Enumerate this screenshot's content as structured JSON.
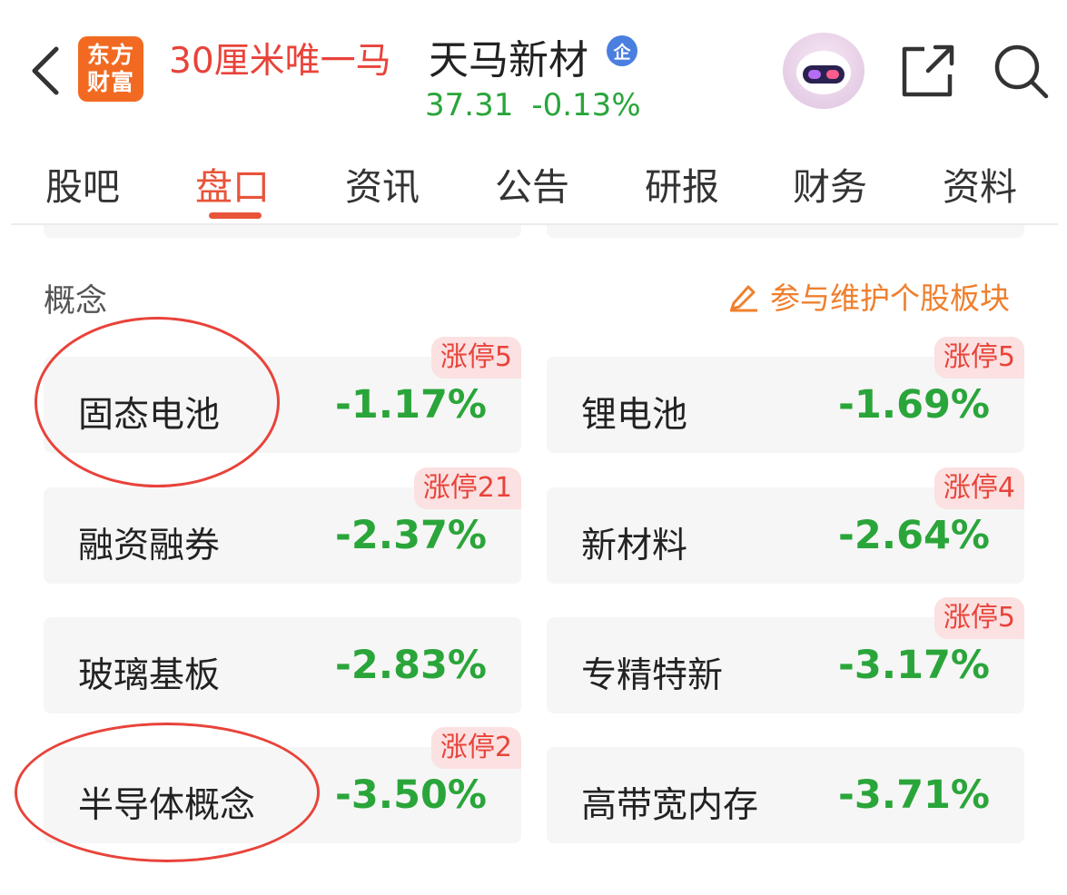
{
  "header": {
    "logo_line1": "东方",
    "logo_line2": "财富",
    "annotation": "30厘米唯一马",
    "stock_name": "天马新材",
    "badge": "企",
    "price": "37.31",
    "change": "-0.13%"
  },
  "tabs": [
    "股吧",
    "盘口",
    "资讯",
    "公告",
    "研报",
    "财务",
    "资料"
  ],
  "active_tab": "盘口",
  "concepts": {
    "title": "概念",
    "maintain_link": "参与维护个股板块",
    "items": [
      {
        "name": "固态电池",
        "change": "-1.17%",
        "limit_up": "涨停5"
      },
      {
        "name": "锂电池",
        "change": "-1.69%",
        "limit_up": "涨停5"
      },
      {
        "name": "融资融券",
        "change": "-2.37%",
        "limit_up": "涨停21"
      },
      {
        "name": "新材料",
        "change": "-2.64%",
        "limit_up": "涨停4"
      },
      {
        "name": "玻璃基板",
        "change": "-2.83%",
        "limit_up": ""
      },
      {
        "name": "专精特新",
        "change": "-3.17%",
        "limit_up": "涨停5"
      },
      {
        "name": "半导体概念",
        "change": "-3.50%",
        "limit_up": "涨停2"
      },
      {
        "name": "高带宽内存",
        "change": "-3.71%",
        "limit_up": ""
      }
    ]
  },
  "colors": {
    "accent": "#e8543a",
    "down_green": "#2aa53a",
    "annotation_red": "#e8433a",
    "brand_orange": "#f26a22",
    "link_orange": "#ef7f2d"
  }
}
